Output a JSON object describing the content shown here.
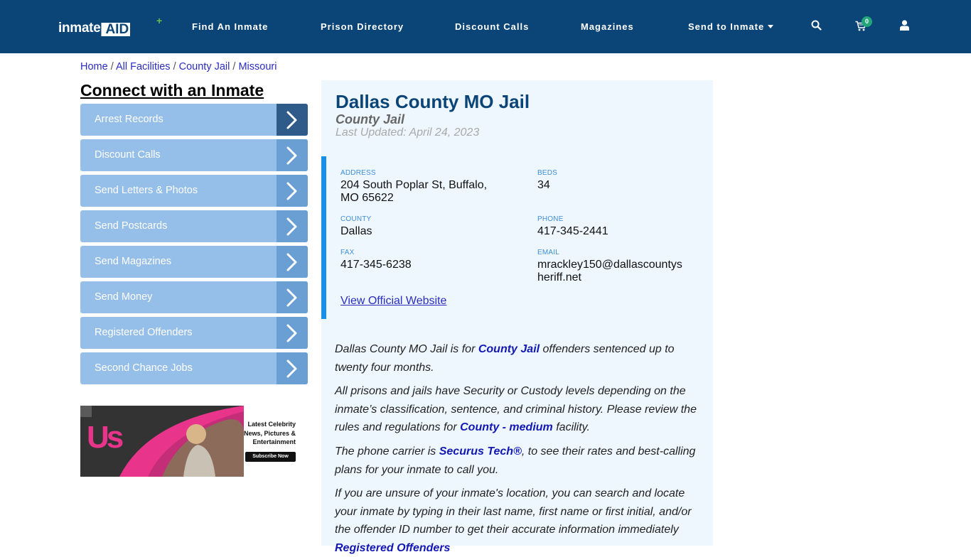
{
  "header": {
    "logo_text_1": "inmate",
    "logo_text_2": "AID",
    "logo_plus": "+",
    "nav": [
      {
        "label": "Find An Inmate"
      },
      {
        "label": "Prison Directory"
      },
      {
        "label": "Discount Calls"
      },
      {
        "label": "Magazines"
      },
      {
        "label": "Send to Inmate"
      }
    ],
    "icons": {
      "search": "search-icon",
      "cart": "cart-icon",
      "user": "user-icon"
    },
    "cart_count": "0"
  },
  "breadcrumb": [
    {
      "label": "Home"
    },
    {
      "label": "All Facilities"
    },
    {
      "label": "County Jail"
    },
    {
      "label": "Missouri"
    }
  ],
  "breadcrumb_separator": "/",
  "sidebar": {
    "title": "Connect with an Inmate",
    "items": [
      {
        "label": "Arrest Records"
      },
      {
        "label": "Discount Calls"
      },
      {
        "label": "Send Letters & Photos"
      },
      {
        "label": "Send Postcards"
      },
      {
        "label": "Send Magazines"
      },
      {
        "label": "Send Money"
      },
      {
        "label": "Registered Offenders"
      },
      {
        "label": "Second Chance Jobs"
      }
    ],
    "ad": {
      "brand": "Us",
      "text_line1": "Latest Celebrity",
      "text_line2": "News, Pictures &",
      "text_line3": "Entertainment",
      "button": "Subscribe Now"
    }
  },
  "facility": {
    "name": "Dallas County MO Jail",
    "type": "County Jail",
    "last_updated": "Last Updated: April 24, 2023",
    "fields": {
      "address_label": "ADDRESS",
      "address_line1": "204 South Poplar St, Buffalo,",
      "address_line2": "MO 65622",
      "beds_label": "BEDS",
      "beds": "34",
      "county_label": "COUNTY",
      "county": "Dallas",
      "phone_label": "PHONE",
      "phone": "417-345-2441",
      "fax_label": "FAX",
      "fax": "417-345-6238",
      "email_label": "EMAIL",
      "email_line1": "mrackley150@dallascountys",
      "email_line2": "heriff.net"
    },
    "website_link": "View Official Website"
  },
  "description": {
    "p1_a": "Dallas County MO Jail is for ",
    "p1_link": "County Jail",
    "p1_b": " offenders sentenced up to twenty four months.",
    "p2_a": "All prisons and jails have Security or Custody levels depending on the inmate’s classification, sentence, and criminal history. Please review the rules and regulations for ",
    "p2_link": "County - medium",
    "p2_b": " facility.",
    "p3_a": "The phone carrier is ",
    "p3_link": "Securus Tech®",
    "p3_b": ", to see their rates and best-calling plans for your inmate to call you.",
    "p4": "If you are unsure of your inmate's location, you can search and locate your inmate by typing in their last name, first name or first initial, and/or the offender ID number to get their accurate information immediately",
    "p4_link": "Registered Offenders"
  },
  "colors": {
    "navbar": "#0b4477",
    "sidebar_item": "#95bfe8",
    "sidebar_arrow": "#6a9fd3",
    "sidebar_arrow_active": "#2e5b8a",
    "card_bg": "#eef7fe",
    "accent_bar": "#1690e8",
    "link": "#1118b5",
    "cart_badge": "#21a67a"
  }
}
